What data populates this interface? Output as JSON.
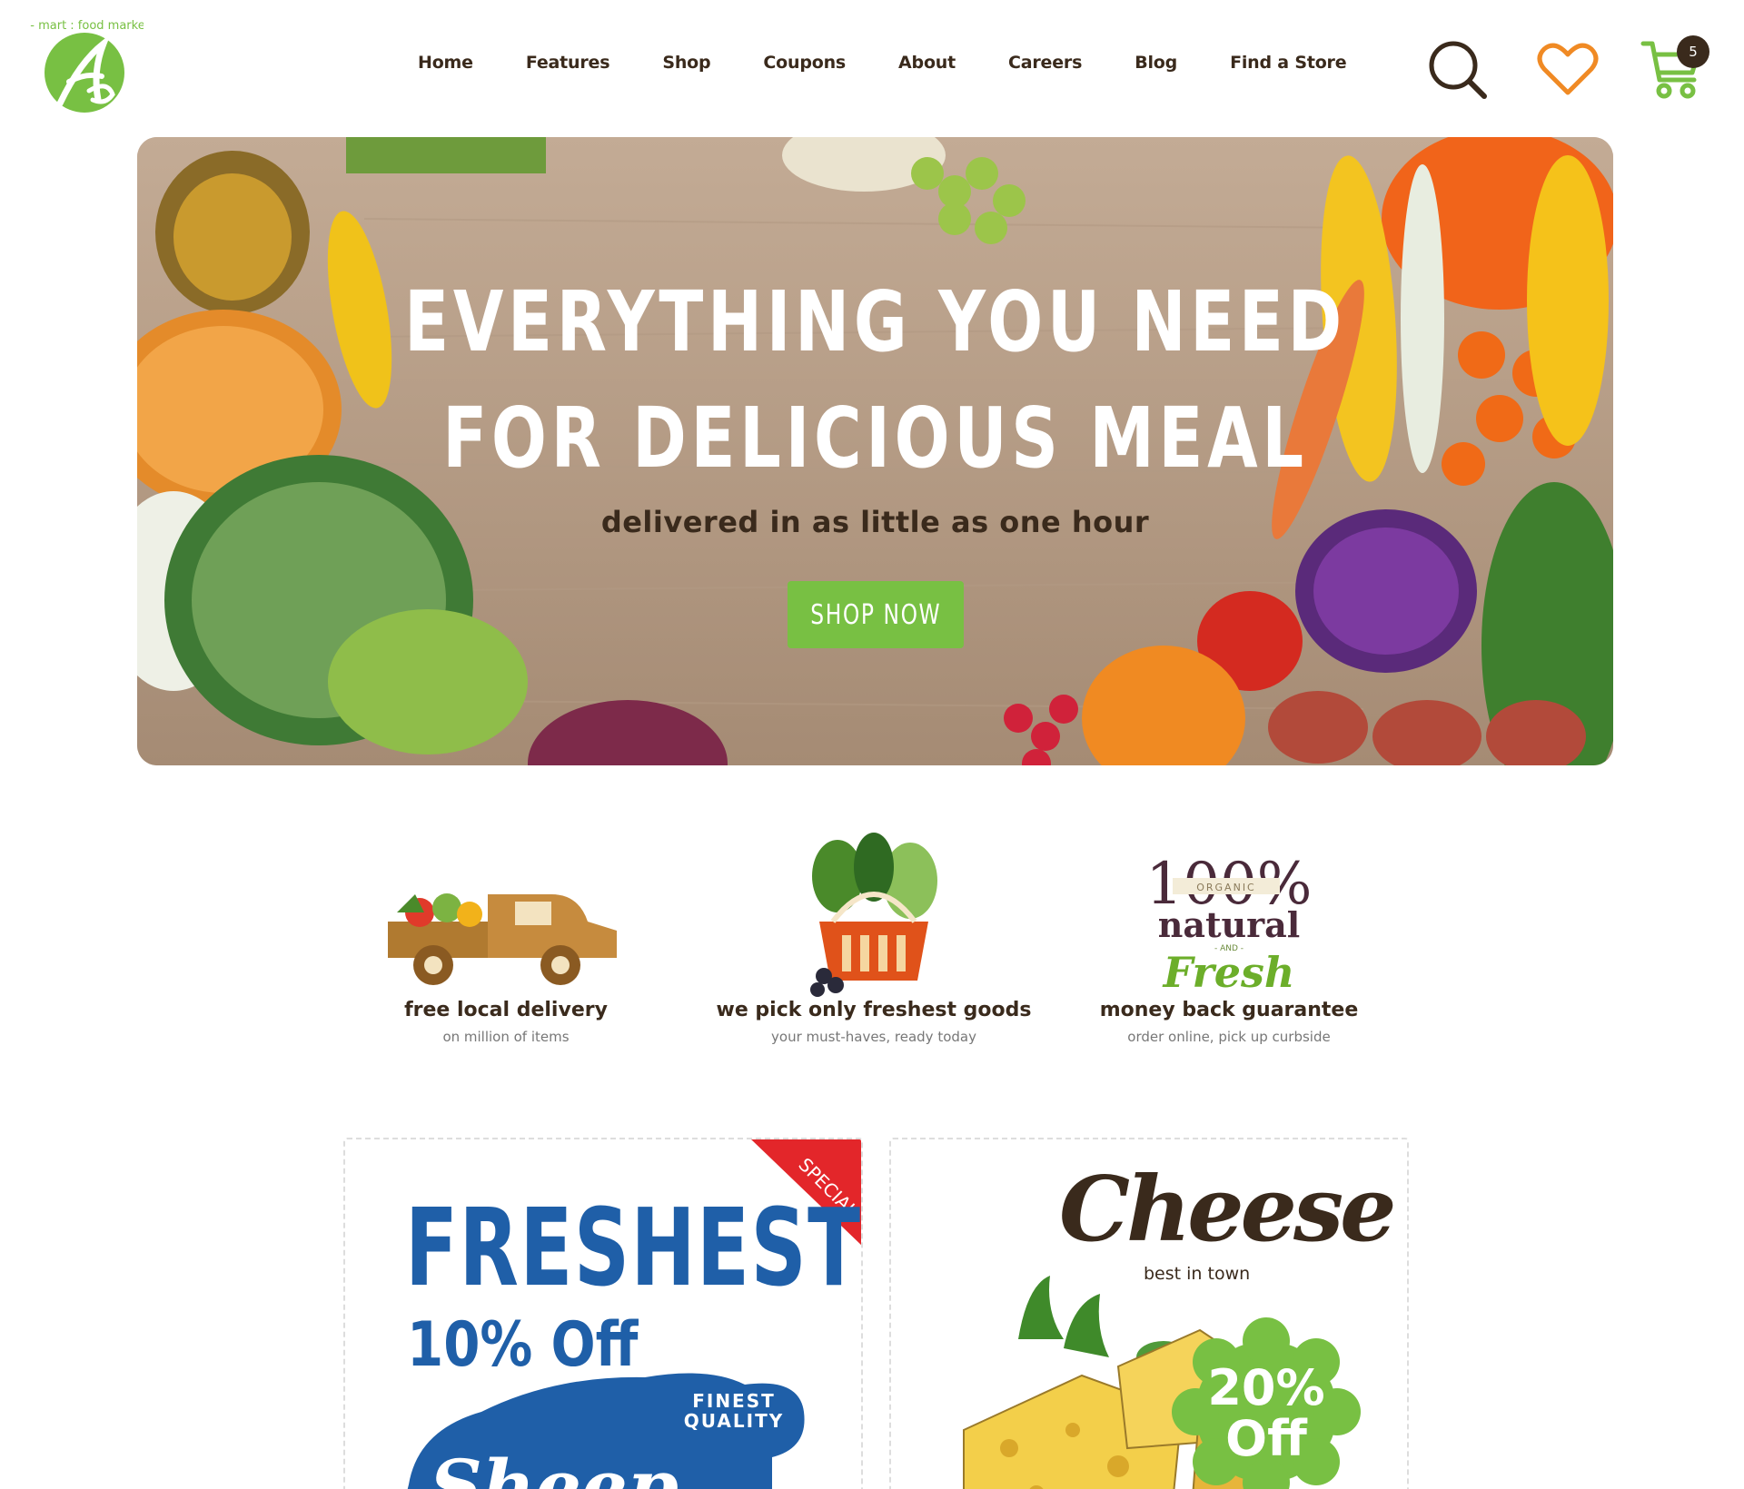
{
  "brand": {
    "logo_letter": "A",
    "logo_text": "a - mart : food market",
    "colors": {
      "green": "#78c043",
      "dark_brown": "#3a2a1c",
      "orange": "#f08a24",
      "blue": "#1f5fa8",
      "red": "#e3262a"
    }
  },
  "nav": {
    "items": [
      "Home",
      "Features",
      "Shop",
      "Coupons",
      "About",
      "Careers",
      "Blog",
      "Find a Store"
    ]
  },
  "header_icons": {
    "search": "search-icon",
    "wishlist": "heart-icon",
    "cart": "cart-icon",
    "cart_count": "5"
  },
  "hero": {
    "title_line1": "EVERYTHING YOU NEED",
    "title_line2": "FOR DELICIOUS MEAL",
    "subtitle": "delivered in as little as one hour",
    "cta": "SHOP NOW"
  },
  "features": [
    {
      "title": "free local delivery",
      "subtitle": "on million of items",
      "icon": "delivery-truck-icon"
    },
    {
      "title": "we pick only freshest goods",
      "subtitle": "your must-haves, ready today",
      "icon": "vegetable-basket-icon"
    },
    {
      "title": "money back guarantee",
      "subtitle": "order online, pick up curbside",
      "icon": "organic-badge-icon"
    }
  ],
  "organic_badge": {
    "percent": "100%",
    "organic": "ORGANIC",
    "natural": "natural",
    "and": "- AND -",
    "fresh": "Fresh"
  },
  "promos": {
    "left": {
      "ribbon": "SPECIAL",
      "headline": "FRESHEST",
      "discount": "10% Off",
      "tag_top": "FINEST",
      "tag_bottom": "QUALITY",
      "product": "Sheep"
    },
    "right": {
      "headline": "Cheese",
      "subtitle": "best in town",
      "discount_line1": "20%",
      "discount_line2": "Off"
    }
  }
}
